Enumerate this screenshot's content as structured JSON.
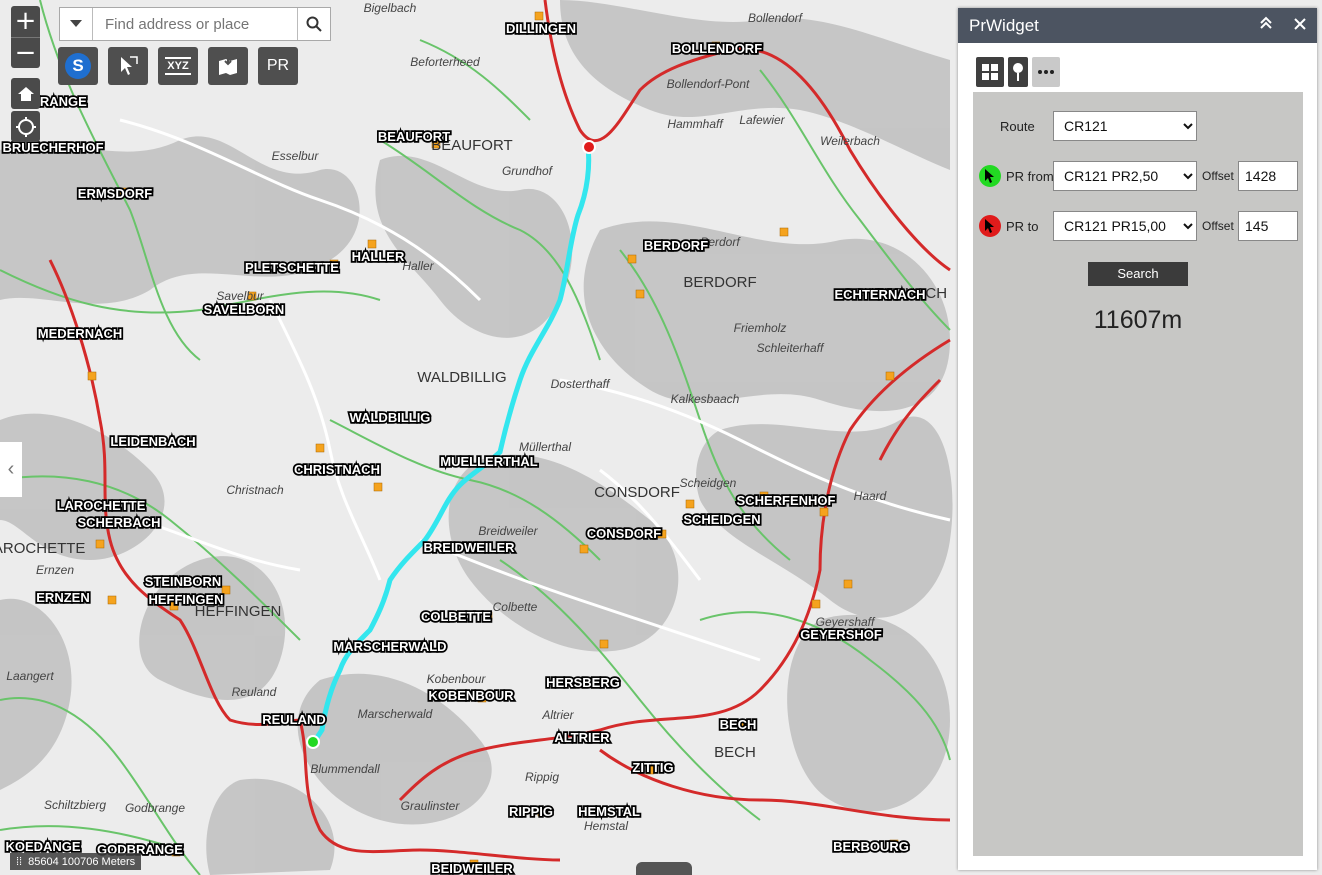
{
  "map": {
    "search_placeholder": "Find address or place",
    "scale_text": "85604 100706 Meters",
    "toolbar": [
      {
        "name": "s-tool",
        "label": "S"
      },
      {
        "name": "measure-tool",
        "label": ""
      },
      {
        "name": "xyz-tool",
        "label": "XYZ"
      },
      {
        "name": "print-tool",
        "label": ""
      },
      {
        "name": "pr-tool",
        "label": "PR"
      }
    ],
    "places": [
      "DILLINGEN",
      "BOLLENDORF",
      "BEAUFORT",
      "ERMSDORF",
      "BRUECHERHOF",
      "EDERANGE",
      "HALLER",
      "PLETSCHETTE",
      "SAVELBORN",
      "MEDERNACH",
      "BERDORF",
      "ECHTERNACH",
      "WALDBILLIG",
      "MUELLERTHAL",
      "CHRISTNACH",
      "LEIDENBACH",
      "LAROCHETTE",
      "SCHERBACH",
      "CONSDORF",
      "SCHEIDGEN",
      "SCHERFENHOF",
      "BREIDWEILER",
      "STEINBORN",
      "HEFFINGEN",
      "ERNZEN",
      "COLBETTE",
      "MARSCHERWALD",
      "GEYERSHOF",
      "KOBENBOUR",
      "HERSBERG",
      "REULAND",
      "BECH",
      "ALTRIER",
      "ZITTIG",
      "RIPPIG",
      "HEMSTAL",
      "BERBOURG",
      "GODBRANGE",
      "KOEDANGE",
      "BEIDWEILER"
    ],
    "base_labels": [
      "Bigelbach",
      "Bollendorf",
      "Beforterheed",
      "Bollendorf-Pont",
      "BEAUFORT",
      "Grundhof",
      "Weilerbach",
      "Lafewier",
      "Hammhaff",
      "Esselbur",
      "Haller",
      "Savelbur",
      "Berdorf",
      "BERDORF",
      "ECHTERNACH",
      "Friemholz",
      "WALDBILLIG",
      "Müllerthal",
      "Dosterthaff",
      "Kalkesbaach",
      "Christnach",
      "CONSDORF",
      "Scheidgen",
      "Colbette",
      "Breidweiler",
      "HEFFINGEN",
      "Reuland",
      "Marscherwald",
      "Kobenbour",
      "Altrier",
      "Rippig",
      "BECH",
      "Graulinster",
      "Godbrange",
      "Blummendall",
      "Ernzen",
      "Haard",
      "Geyershaff",
      "LAROCHETTE",
      "Laangert",
      "Hemstal",
      "Schiltzbierg",
      "Schleiterhaff"
    ]
  },
  "widget": {
    "title": "PrWidget",
    "route_label": "Route",
    "route_value": "CR121",
    "from_label": "PR from",
    "from_value": "CR121 PR2,50",
    "to_label": "PR to",
    "to_value": "CR121 PR15,00",
    "offset_label": "Offset",
    "from_offset": "1428",
    "to_offset": "145",
    "search_label": "Search",
    "result": "11607m",
    "colors": {
      "from": "#22d922",
      "to": "#e01b1b",
      "route": "#33e6ee",
      "header": "#4c5461"
    }
  }
}
